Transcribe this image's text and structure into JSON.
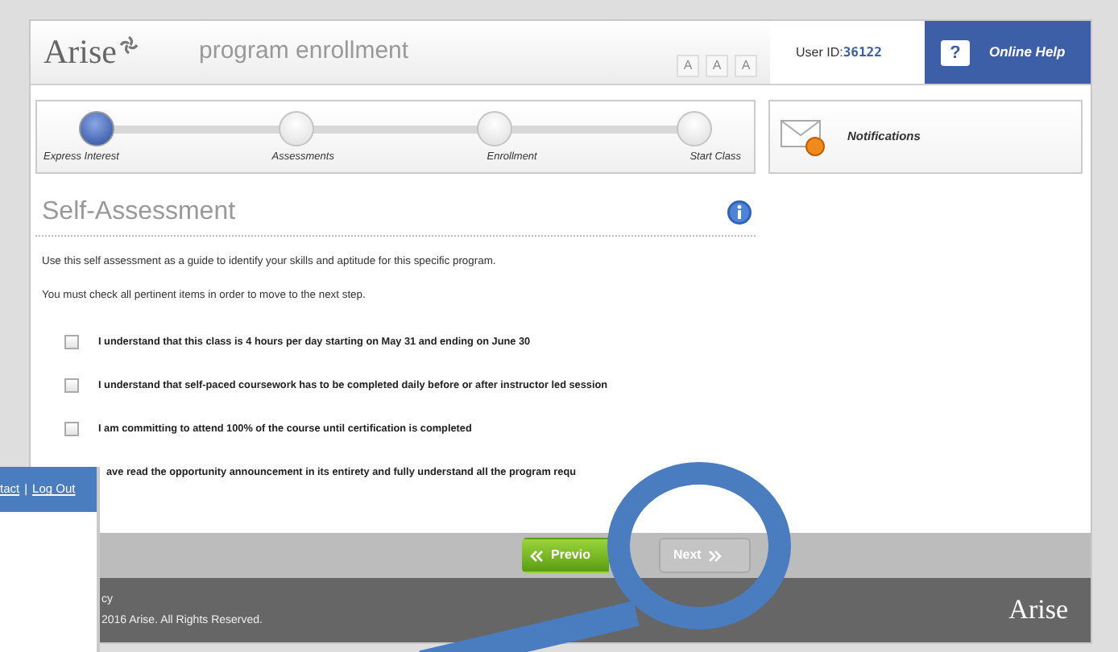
{
  "header": {
    "logo": "Arise",
    "title": "program enrollment",
    "font_size_buttons": [
      "A",
      "A",
      "A"
    ],
    "user_id_label": "User ID:",
    "user_id": "36122",
    "help_glyph": "?",
    "help": "Online Help"
  },
  "steps": [
    {
      "label": "Express Interest",
      "current": true
    },
    {
      "label": "Assessments",
      "current": false
    },
    {
      "label": "Enrollment",
      "current": false
    },
    {
      "label": "Start Class",
      "current": false
    }
  ],
  "notifications": "Notifications",
  "heading": "Self-Assessment",
  "intro": [
    "Use this self assessment as a guide to identify your skills and aptitude for this specific program.",
    "You must check all pertinent items in order to move to the next step."
  ],
  "items": [
    {
      "kind": "checkbox",
      "text": "I understand that this class is 4 hours per day starting on May 31 and ending on June 30",
      "checked": false
    },
    {
      "kind": "checkbox",
      "text": "I understand that self-paced coursework has to be completed daily before or after instructor led session",
      "checked": false
    },
    {
      "kind": "checkbox",
      "text": "I am committing to attend 100% of the course until certification is completed",
      "checked": false
    },
    {
      "kind": "covered",
      "text": "ave read the opportunity announcement in its entirety and fully understand all the program requ"
    }
  ],
  "buttons": [
    {
      "label": "Previo",
      "enabled": true
    },
    {
      "label": "Next",
      "enabled": false
    }
  ],
  "footer": {
    "lines": [
      "cy",
      "2016 Arise. All Rights Reserved."
    ],
    "logo": "Arise"
  },
  "overlay_panel": {
    "links": [
      "tact",
      "Log Out"
    ],
    "separator": "|"
  }
}
